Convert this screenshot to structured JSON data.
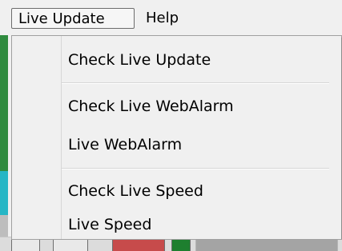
{
  "menubar": {
    "items": [
      {
        "label": "Live Update"
      },
      {
        "label": "Help"
      }
    ]
  },
  "dropdown": {
    "items": [
      {
        "label": "Check Live Update"
      },
      {
        "label": "Check Live WebAlarm"
      },
      {
        "label": "Live WebAlarm"
      },
      {
        "label": "Check Live Speed"
      },
      {
        "label": "Live Speed"
      }
    ]
  }
}
